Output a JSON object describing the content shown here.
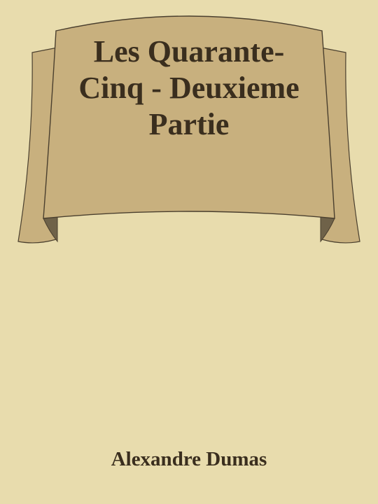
{
  "book": {
    "title": "Les Quarante-Cinq - Deuxieme Partie",
    "author": "Alexandre Dumas"
  },
  "colors": {
    "background": "#e8dcad",
    "banner_fill": "#c8b07e",
    "banner_shadow": "#6f6249",
    "outline": "#4a3f2e",
    "text": "#3a2e1e"
  }
}
